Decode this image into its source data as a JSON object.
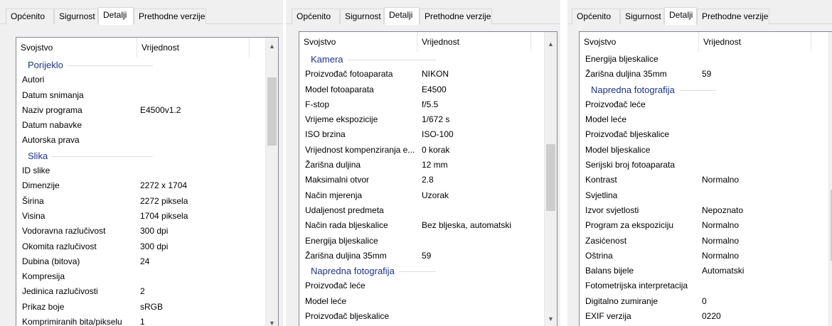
{
  "panels": [
    {
      "tabs": [
        "Općenito",
        "Sigurnost",
        "Detalji",
        "Prethodne verzije"
      ],
      "active_tab": 2,
      "columns": [
        "Svojstvo",
        "Vrijednost"
      ],
      "scroll_up_icon": "chevron-up-icon",
      "scroll_down_icon": "chevron-down-icon",
      "rows": [
        {
          "group": "Porijeklo"
        },
        {
          "prop": "Autori",
          "val": ""
        },
        {
          "prop": "Datum snimanja",
          "val": ""
        },
        {
          "prop": "Naziv programa",
          "val": "E4500v1.2"
        },
        {
          "prop": "Datum nabavke",
          "val": ""
        },
        {
          "prop": "Autorska prava",
          "val": ""
        },
        {
          "group": "Slika"
        },
        {
          "prop": "ID slike",
          "val": ""
        },
        {
          "prop": "Dimenzije",
          "val": "2272 x 1704"
        },
        {
          "prop": "Širina",
          "val": "2272 piksela"
        },
        {
          "prop": "Visina",
          "val": "1704 piksela"
        },
        {
          "prop": "Vodoravna razlučivost",
          "val": "300 dpi"
        },
        {
          "prop": "Okomita razlučivost",
          "val": "300 dpi"
        },
        {
          "prop": "Dubina (bitova)",
          "val": "24"
        },
        {
          "prop": "Kompresija",
          "val": ""
        },
        {
          "prop": "Jedinica razlučivosti",
          "val": "2"
        },
        {
          "prop": "Prikaz boje",
          "val": "sRGB"
        },
        {
          "prop": "Komprimiranih bita/pikselu",
          "val": "1"
        }
      ]
    },
    {
      "tabs": [
        "Općenito",
        "Sigurnost",
        "Detalji",
        "Prethodne verzije"
      ],
      "active_tab": 2,
      "columns": [
        "Svojstvo",
        "Vrijednost"
      ],
      "scroll_up_icon": "chevron-up-icon",
      "scroll_down_icon": "chevron-down-icon",
      "rows": [
        {
          "group": "Kamera"
        },
        {
          "prop": "Proizvođač fotoaparata",
          "val": "NIKON"
        },
        {
          "prop": "Model fotoaparata",
          "val": "E4500"
        },
        {
          "prop": "F-stop",
          "val": "f/5.5"
        },
        {
          "prop": "Vrijeme ekspozicije",
          "val": "1/672 s"
        },
        {
          "prop": "ISO brzina",
          "val": "ISO-100"
        },
        {
          "prop": "Vrijednost kompenziranja e...",
          "val": "0 korak"
        },
        {
          "prop": "Žarišna duljina",
          "val": "12 mm"
        },
        {
          "prop": "Maksimalni otvor",
          "val": "2.8"
        },
        {
          "prop": "Način mjerenja",
          "val": "Uzorak"
        },
        {
          "prop": "Udaljenost predmeta",
          "val": ""
        },
        {
          "prop": "Način rada bljeskalice",
          "val": "Bez bljeska, automatski"
        },
        {
          "prop": "Energija bljeskalice",
          "val": ""
        },
        {
          "prop": "Žarišna duljina 35mm",
          "val": "59"
        },
        {
          "group": "Napredna fotografija"
        },
        {
          "prop": "Proizvođač leće",
          "val": ""
        },
        {
          "prop": "Model leće",
          "val": ""
        },
        {
          "prop": "Proizvođač bljeskalice",
          "val": ""
        }
      ]
    },
    {
      "tabs": [
        "Općenito",
        "Sigurnost",
        "Detalji",
        "Prethodne verzije"
      ],
      "active_tab": 2,
      "columns": [
        "Svojstvo",
        "Vrijednost"
      ],
      "scroll_up_icon": "chevron-up-icon",
      "scroll_down_icon": "chevron-down-icon",
      "rows": [
        {
          "prop": "Energija bljeskalice",
          "val": ""
        },
        {
          "prop": "Žarišna duljina 35mm",
          "val": "59"
        },
        {
          "group": "Napredna fotografija"
        },
        {
          "prop": "Proizvođač leće",
          "val": ""
        },
        {
          "prop": "Model leće",
          "val": ""
        },
        {
          "prop": "Proizvođač bljeskalice",
          "val": ""
        },
        {
          "prop": "Model bljeskalice",
          "val": ""
        },
        {
          "prop": "Serijski broj fotoaparata",
          "val": ""
        },
        {
          "prop": "Kontrast",
          "val": "Normalno"
        },
        {
          "prop": "Svjetlina",
          "val": ""
        },
        {
          "prop": "Izvor svjetlosti",
          "val": "Nepoznato"
        },
        {
          "prop": "Program za ekspoziciju",
          "val": "Normalno"
        },
        {
          "prop": "Zasićenost",
          "val": "Normalno"
        },
        {
          "prop": "Oštrina",
          "val": "Normalno"
        },
        {
          "prop": "Balans bijele",
          "val": "Automatski"
        },
        {
          "prop": "Fotometrijska interpretacija",
          "val": ""
        },
        {
          "prop": "Digitalno zumiranje",
          "val": "0"
        },
        {
          "prop": "EXIF verzija",
          "val": "0220"
        }
      ]
    }
  ]
}
